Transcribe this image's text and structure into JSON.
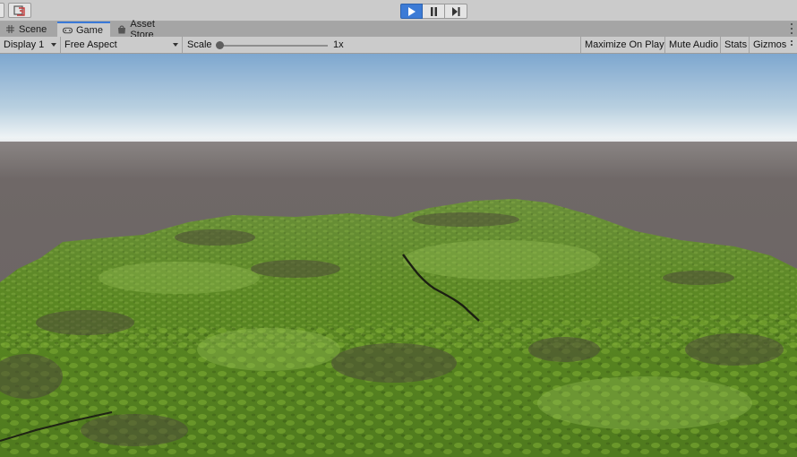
{
  "toolbar": {
    "left_tools": [
      "layers-icon",
      "collab-icon"
    ],
    "playmode": [
      {
        "name": "play",
        "icon": "play-icon",
        "active": true
      },
      {
        "name": "pause",
        "icon": "pause-icon",
        "active": false
      },
      {
        "name": "step",
        "icon": "step-icon",
        "active": false
      }
    ]
  },
  "tabs": [
    {
      "label": "Scene",
      "icon": "grid-icon",
      "active": false
    },
    {
      "label": "Game",
      "icon": "gamepad-icon",
      "active": true
    },
    {
      "label": "Asset Store",
      "icon": "store-icon",
      "active": false
    }
  ],
  "game_toolbar": {
    "display": "Display 1",
    "aspect": "Free Aspect",
    "scale_label": "Scale",
    "scale_value": "1x",
    "scale_level": 0.0,
    "toggles": [
      "Maximize On Play",
      "Mute Audio",
      "Stats",
      "Gizmos"
    ]
  },
  "viewport": {
    "sky_top": "#7ea7cf",
    "sky_horizon": "#eef3f5",
    "ground": "#6e6766",
    "grass": "#58831f"
  },
  "colors": {
    "accent": "#3c7bd6",
    "toolbar_bg": "#cbcbcb"
  }
}
